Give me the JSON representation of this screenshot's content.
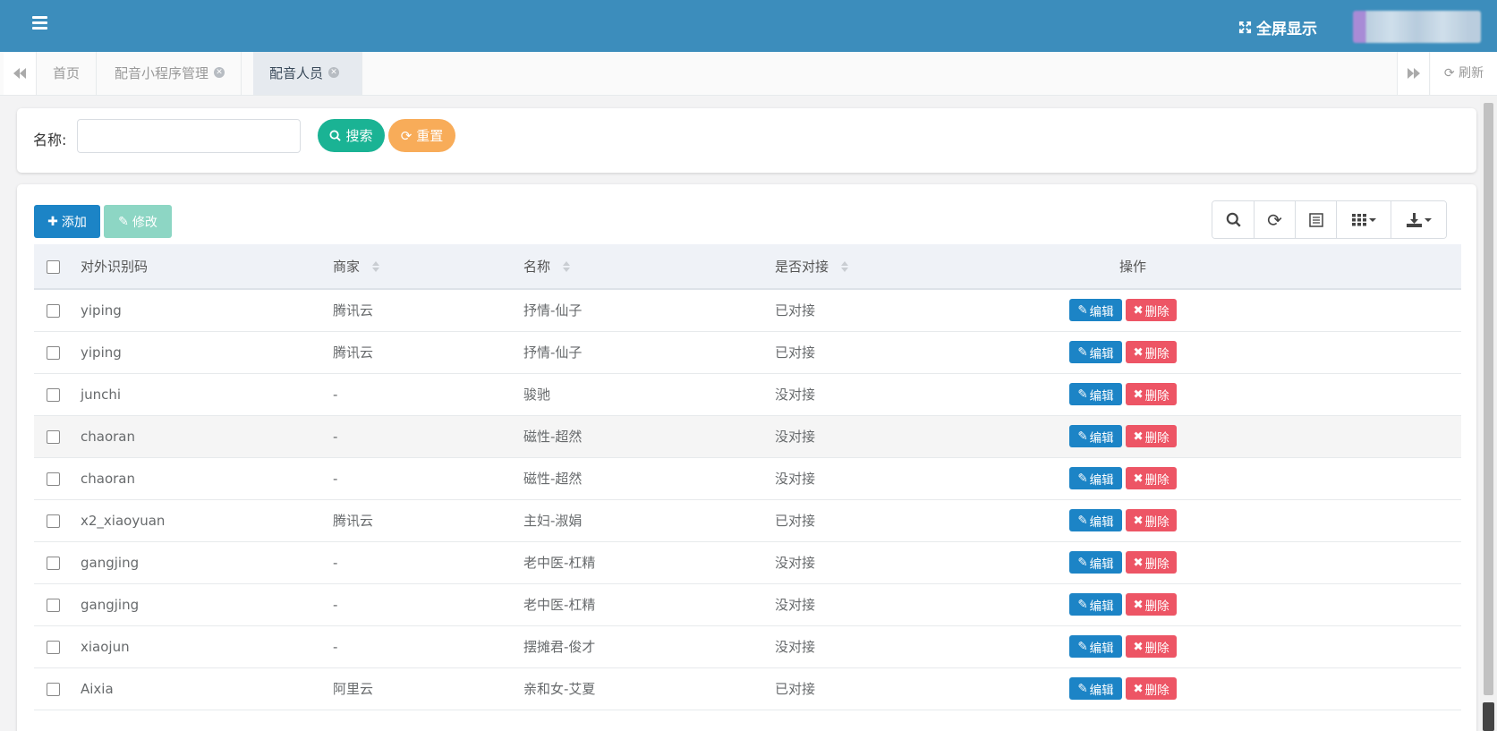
{
  "topbar": {
    "fullscreen_label": "全屏显示",
    "fullscreen_icon": "expand-icon",
    "menu_icon": "hamburger-icon"
  },
  "tabs": {
    "items": [
      {
        "label": "首页",
        "closable": false,
        "active": false
      },
      {
        "label": "配音小程序管理",
        "closable": true,
        "active": false
      },
      {
        "label": "配音人员",
        "closable": true,
        "active": true
      }
    ],
    "refresh_label": "刷新"
  },
  "search": {
    "name_label": "名称:",
    "name_value": "",
    "search_button": "搜索",
    "reset_button": "重置"
  },
  "toolbar": {
    "add_label": "添加",
    "edit_label": "修改",
    "tools": [
      "search-icon",
      "refresh-icon",
      "list-view-icon",
      "columns-icon",
      "export-icon"
    ]
  },
  "table": {
    "columns": [
      "对外识别码",
      "商家",
      "名称",
      "是否对接",
      "操作"
    ],
    "edit_action": "编辑",
    "delete_action": "删除",
    "rows": [
      {
        "code": "yiping",
        "merchant": "腾讯云",
        "name": "抒情-仙子",
        "status": "已对接"
      },
      {
        "code": "yiping",
        "merchant": "腾讯云",
        "name": "抒情-仙子",
        "status": "已对接"
      },
      {
        "code": "junchi",
        "merchant": "-",
        "name": "骏驰",
        "status": "没对接"
      },
      {
        "code": "chaoran",
        "merchant": "-",
        "name": "磁性-超然",
        "status": "没对接"
      },
      {
        "code": "chaoran",
        "merchant": "-",
        "name": "磁性-超然",
        "status": "没对接"
      },
      {
        "code": "x2_xiaoyuan",
        "merchant": "腾讯云",
        "name": "主妇-淑娟",
        "status": "已对接"
      },
      {
        "code": "gangjing",
        "merchant": "-",
        "name": "老中医-杠精",
        "status": "没对接"
      },
      {
        "code": "gangjing",
        "merchant": "-",
        "name": "老中医-杠精",
        "status": "没对接"
      },
      {
        "code": "xiaojun",
        "merchant": "-",
        "name": "摆摊君-俊才",
        "status": "没对接"
      },
      {
        "code": "Aixia",
        "merchant": "阿里云",
        "name": "亲和女-艾夏",
        "status": "已对接"
      }
    ]
  },
  "colors": {
    "header": "#3c8dbc",
    "primary": "#1c84c6",
    "success": "#1ab394",
    "warning": "#f8ac59",
    "danger": "#ed5565"
  }
}
